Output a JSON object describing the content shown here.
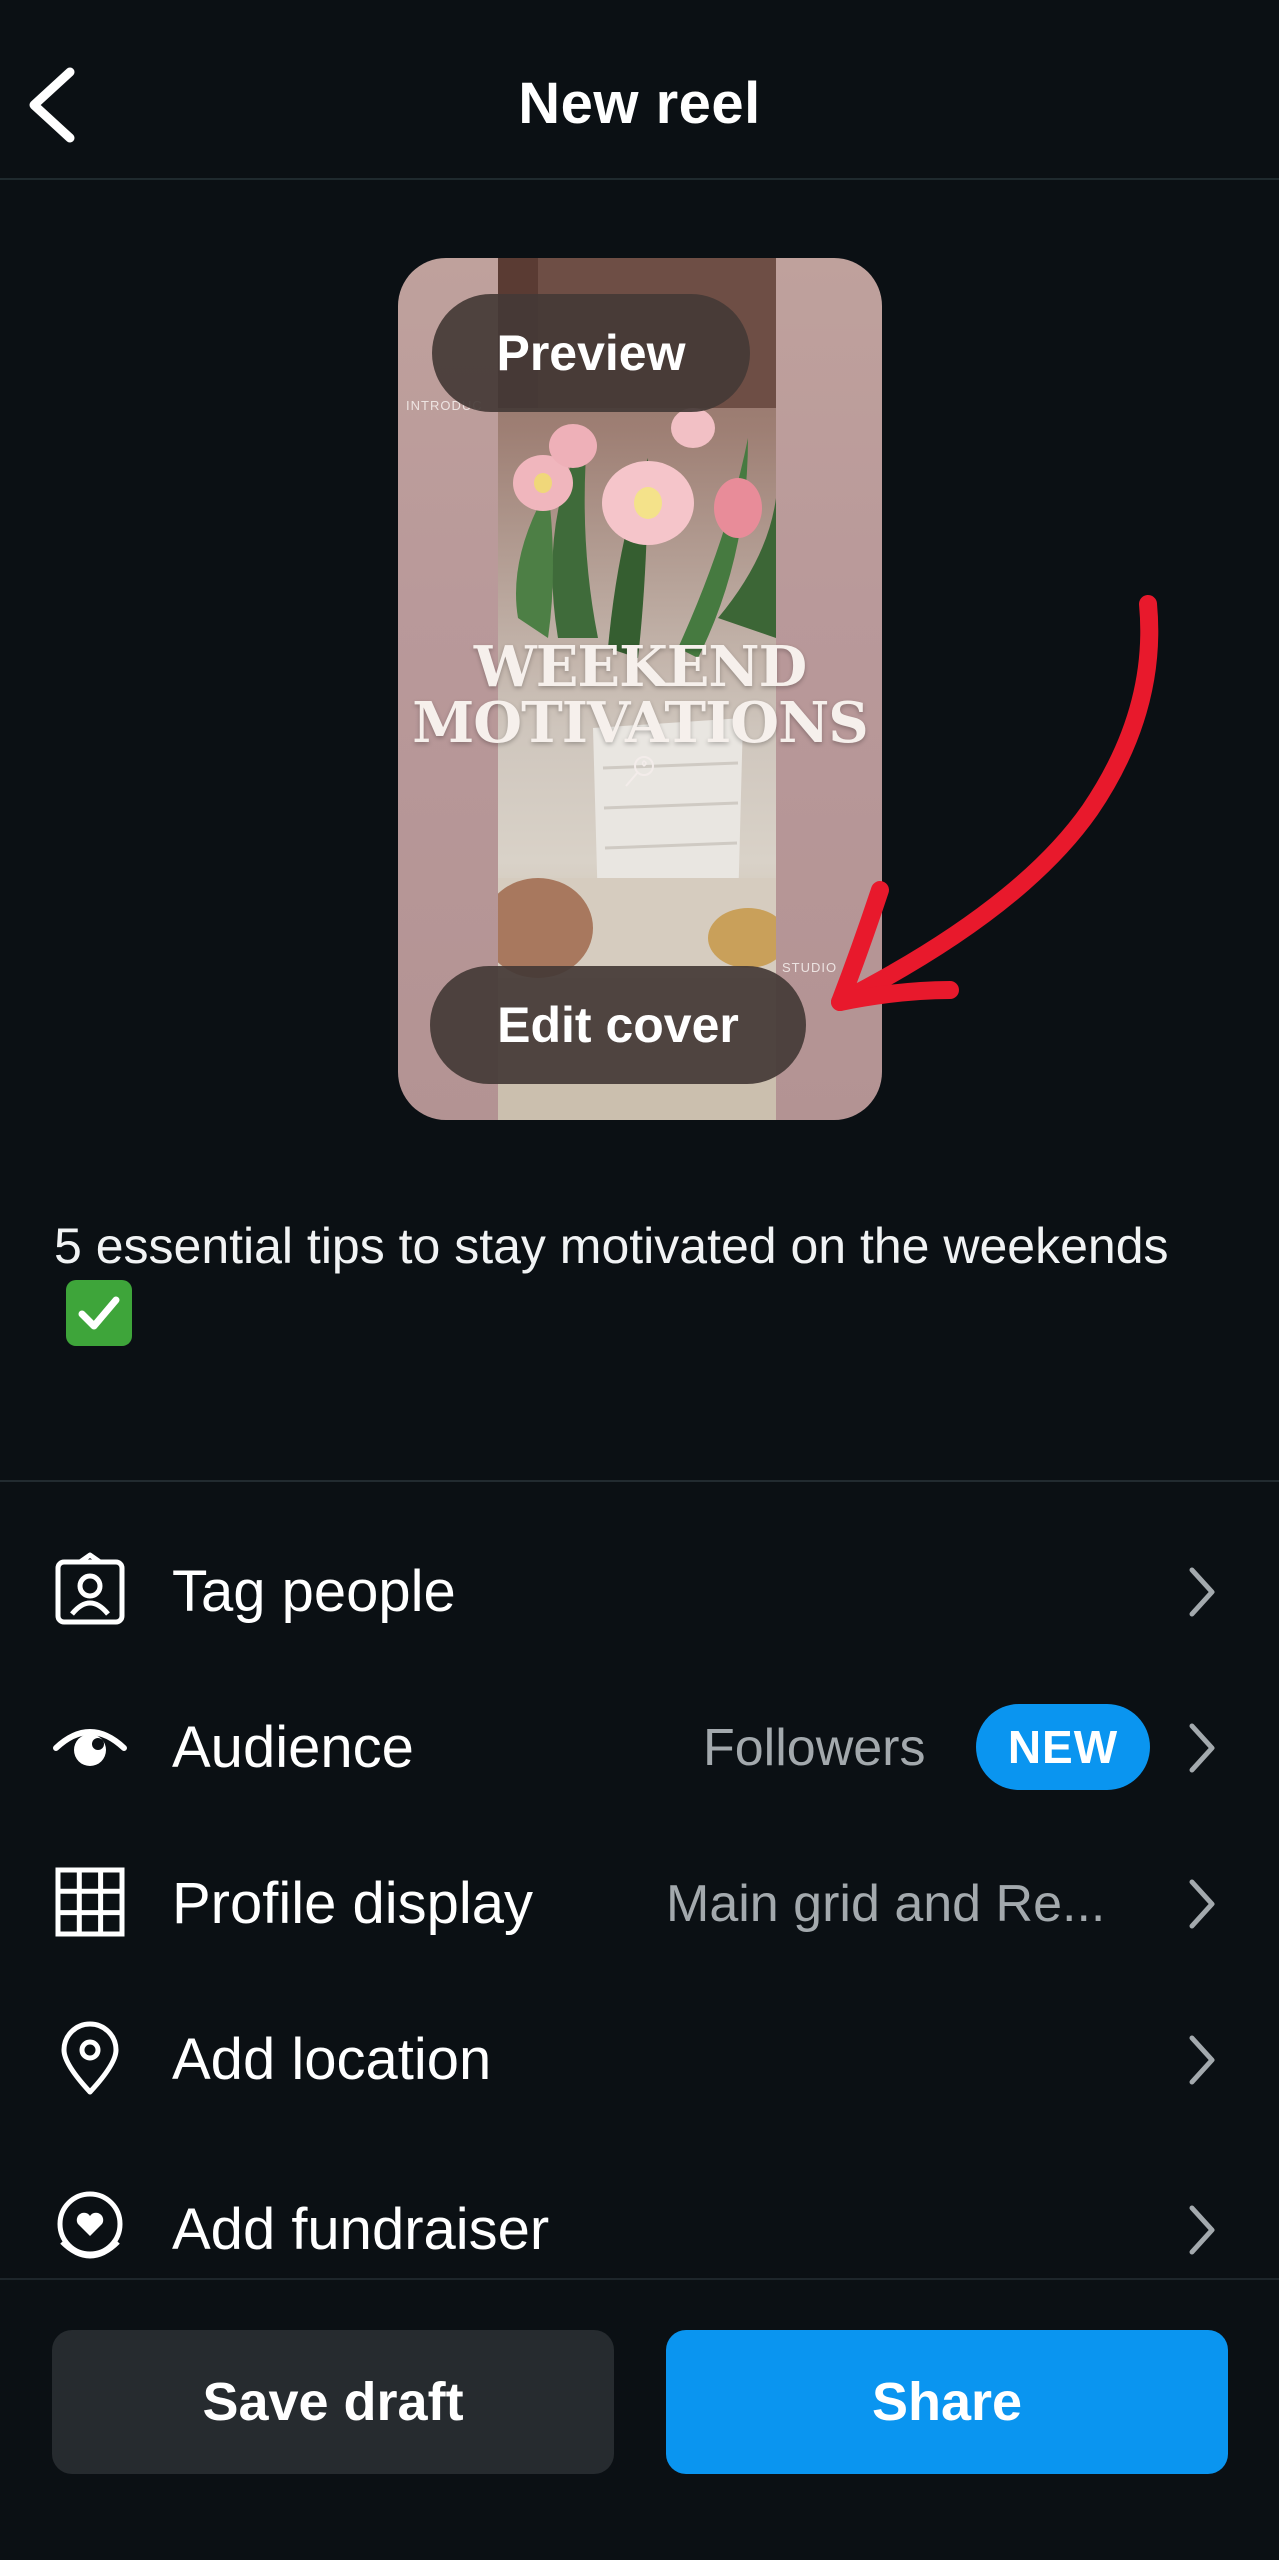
{
  "header": {
    "title": "New reel",
    "back_icon": "chevron-left-icon"
  },
  "reel": {
    "preview_label": "Preview",
    "edit_cover_label": "Edit cover",
    "overlay_title_line1": "WEEKEND",
    "overlay_title_line2": "MOTIVATIONS",
    "side_text_left": "INTRODUC",
    "side_text_right": "STUDIO",
    "annotation_color": "#e8192c"
  },
  "caption": {
    "text": "5 essential tips to stay motivated on the weekends",
    "emoji": "check-mark-button-icon"
  },
  "options": [
    {
      "label": "Tag people",
      "icon": "tag-person-icon",
      "value": "",
      "badge": ""
    },
    {
      "label": "Audience",
      "icon": "eye-icon",
      "value": "Followers",
      "badge": "NEW"
    },
    {
      "label": "Profile display",
      "icon": "grid-icon",
      "value": "Main grid and Re...",
      "badge": ""
    },
    {
      "label": "Add location",
      "icon": "location-pin-icon",
      "value": "",
      "badge": ""
    },
    {
      "label": "Add fundraiser",
      "icon": "fundraiser-heart-icon",
      "value": "",
      "badge": ""
    }
  ],
  "actions": {
    "save_draft": "Save draft",
    "share": "Share"
  },
  "colors": {
    "background": "#0b1014",
    "accent": "#0a95f0",
    "secondary_button": "#262b2f"
  }
}
